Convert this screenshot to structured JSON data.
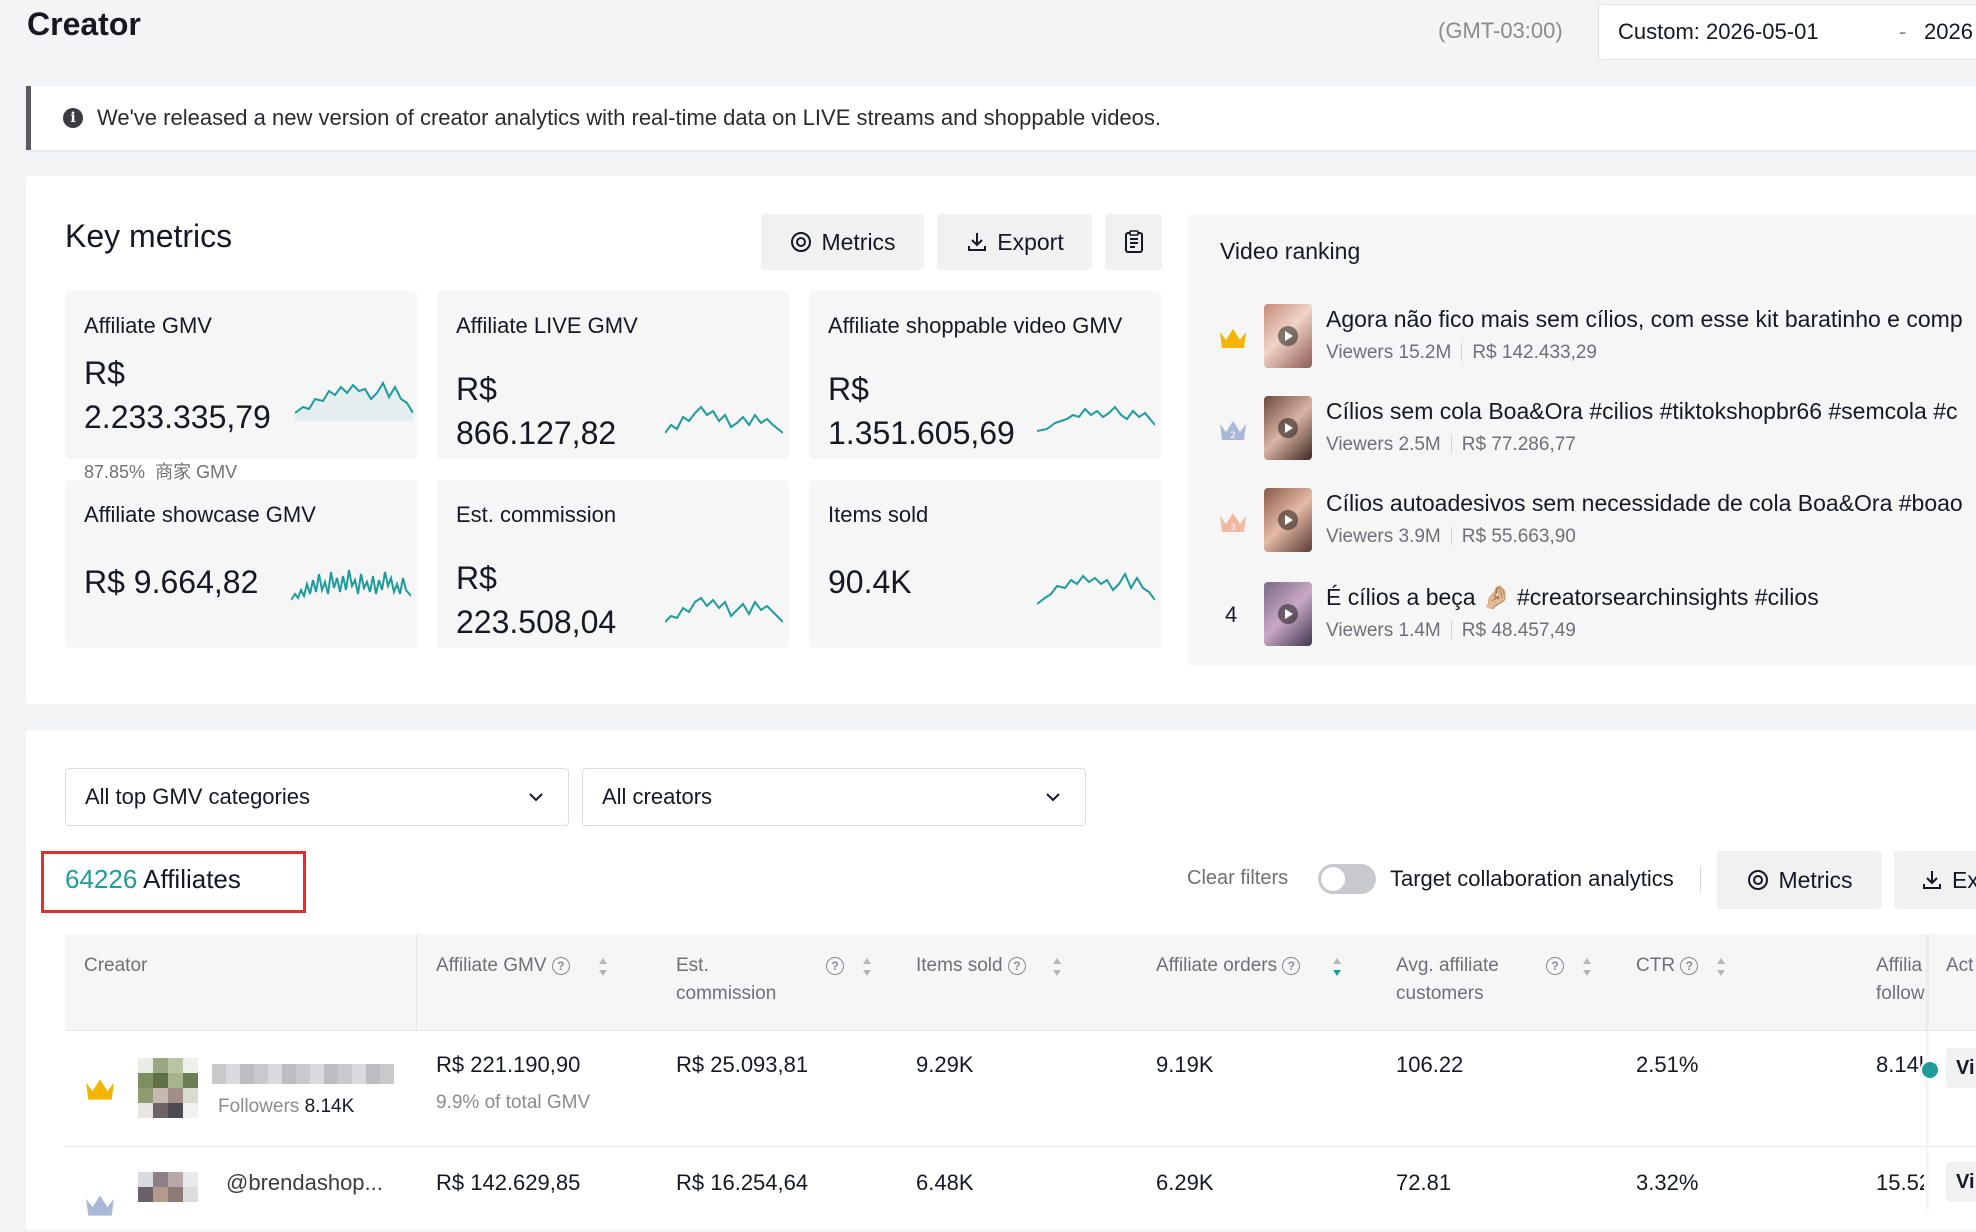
{
  "header": {
    "title": "Creator",
    "timezone": "(GMT-03:00)",
    "date_range": {
      "start": "Custom: 2026-05-01",
      "separator": "-",
      "end": "2026"
    }
  },
  "banner": {
    "text": "We've released a new version of creator analytics with real-time data on LIVE streams and shoppable videos."
  },
  "key_metrics": {
    "title": "Key metrics",
    "buttons": {
      "metrics": "Metrics",
      "export": "Export"
    },
    "cards": [
      {
        "label": "Affiliate GMV",
        "value_line1": "R$",
        "value_line2": "2.233.335,79",
        "note_pct": "87.85%",
        "note_text": "商家 GMV"
      },
      {
        "label": "Affiliate LIVE GMV",
        "value_line1": "R$",
        "value_line2": "866.127,82"
      },
      {
        "label": "Affiliate shoppable video GMV",
        "value_line1": "R$",
        "value_line2": "1.351.605,69"
      },
      {
        "label": "Affiliate showcase GMV",
        "value_line1": "R$ 9.664,82",
        "value_line2": ""
      },
      {
        "label": "Est. commission",
        "value_line1": "R$",
        "value_line2": "223.508,04"
      },
      {
        "label": "Items sold",
        "value_line1": "90.4K",
        "value_line2": ""
      }
    ],
    "sparkline_color": "#1e9c9c"
  },
  "video_ranking": {
    "title": "Video ranking",
    "items": [
      {
        "rank": "1",
        "title": "Agora não fico mais sem cílios, com esse kit baratinho e comp",
        "viewers_label": "Viewers",
        "viewers": "15.2M",
        "gmv": "R$ 142.433,29"
      },
      {
        "rank": "2",
        "title": "Cílios sem cola Boa&Ora #cilios #tiktokshopbr66 #semcola #c",
        "viewers_label": "Viewers",
        "viewers": "2.5M",
        "gmv": "R$ 77.286,77"
      },
      {
        "rank": "3",
        "title": "Cílios autoadesivos sem necessidade de cola Boa&Ora #boao",
        "viewers_label": "Viewers",
        "viewers": "3.9M",
        "gmv": "R$ 55.663,90"
      },
      {
        "rank": "4",
        "title": "É cílios a beça 🤌🏼 #creatorsearchinsights #cilios",
        "viewers_label": "Viewers",
        "viewers": "1.4M",
        "gmv": "R$ 48.457,49"
      }
    ]
  },
  "filters": {
    "category": "All top GMV categories",
    "creators": "All creators",
    "clear": "Clear filters",
    "toggle_label": "Target collaboration analytics",
    "metrics_button": "Metrics",
    "export_button": "Ex"
  },
  "affiliates": {
    "count": "64226",
    "label": " Affiliates"
  },
  "table": {
    "columns": {
      "creator": "Creator",
      "gmv": "Affiliate GMV",
      "commission_1": "Est.",
      "commission_2": "commission",
      "items": "Items sold",
      "orders": "Affiliate orders",
      "avg_1": "Avg. affiliate",
      "avg_2": "customers",
      "ctr": "CTR",
      "foll_1": "Affilia",
      "foll_2": "follow",
      "act": "Act"
    },
    "rows": [
      {
        "name": "",
        "followers_label": "Followers",
        "followers": "8.14K",
        "gmv": "R$ 221.190,90",
        "gmv_share": "9.9% of total GMV",
        "commission": "R$ 25.093,81",
        "items": "9.29K",
        "orders": "9.19K",
        "avg": "106.22",
        "ctr": "2.51%",
        "followers_col": "8.14k",
        "action": "Vi"
      },
      {
        "name": "@brendashop...",
        "gmv": "R$ 142.629,85",
        "commission": "R$ 16.254,64",
        "items": "6.48K",
        "orders": "6.29K",
        "avg": "72.81",
        "ctr": "3.32%",
        "followers_col": "15.52",
        "action": "Vi"
      }
    ]
  }
}
